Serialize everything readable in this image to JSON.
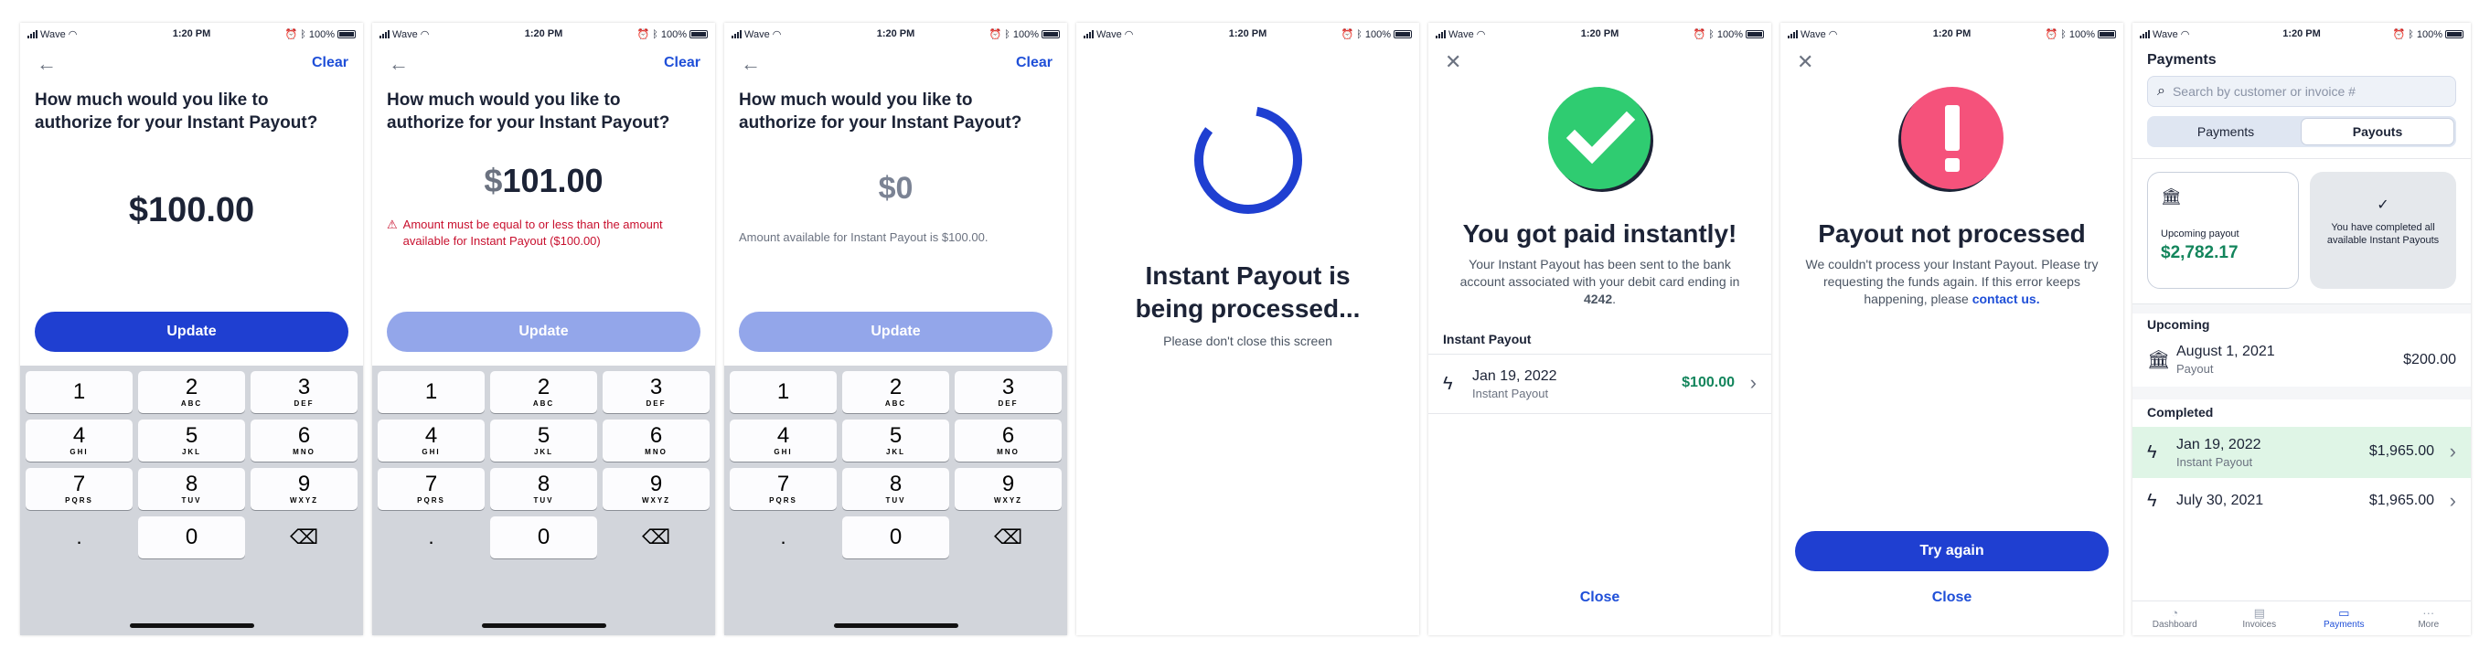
{
  "status": {
    "carrier": "Wave",
    "time": "1:20 PM",
    "battery": "100%"
  },
  "entry": {
    "question": "How much would you like to authorize for your Instant Payout?",
    "clear_label": "Clear",
    "update_label": "Update",
    "screens": [
      {
        "amount": "100.00",
        "message": ""
      },
      {
        "amount": "101.00",
        "message": "Amount must be equal to or less than the amount available for Instant Payout ($100.00)"
      },
      {
        "amount": "0",
        "message": "Amount available for Instant Payout is $100.00."
      }
    ]
  },
  "keypad": {
    "keys": [
      {
        "n": "1",
        "s": ""
      },
      {
        "n": "2",
        "s": "ABC"
      },
      {
        "n": "3",
        "s": "DEF"
      },
      {
        "n": "4",
        "s": "GHI"
      },
      {
        "n": "5",
        "s": "JKL"
      },
      {
        "n": "6",
        "s": "MNO"
      },
      {
        "n": "7",
        "s": "PQRS"
      },
      {
        "n": "8",
        "s": "TUV"
      },
      {
        "n": "9",
        "s": "WXYZ"
      }
    ],
    "dot": ".",
    "zero": "0",
    "delete_icon": "⌫"
  },
  "processing": {
    "title": "Instant Payout is being processed...",
    "subtitle": "Please don't close this screen",
    "spinner_color": "#1f3fd1"
  },
  "success": {
    "title": "You got paid instantly!",
    "body": "Your Instant Payout has been sent to the bank account associated with your debit card ending in",
    "card_last4": "4242",
    "section": "Instant Payout",
    "tx_date": "Jan 19, 2022",
    "tx_label": "Instant Payout",
    "tx_amount": "$100.00",
    "close_label": "Close",
    "icon_color": "#2fcc71"
  },
  "failure": {
    "title": "Payout not processed",
    "body": "We couldn't process your Instant Payout. Please try requesting the funds again. If this error keeps happening, please",
    "link": "contact us.",
    "try_again_label": "Try again",
    "close_label": "Close",
    "icon_color": "#f5527b"
  },
  "payments": {
    "title": "Payments",
    "search_placeholder": "Search by customer or invoice #",
    "tabs": [
      "Payments",
      "Payouts"
    ],
    "upcoming_card": {
      "label": "Upcoming payout",
      "amount": "$2,782.17"
    },
    "completed_card": {
      "text": "You have completed all available Instant Payouts"
    },
    "upcoming_header": "Upcoming",
    "upcoming": [
      {
        "date": "August 1, 2021",
        "label": "Payout",
        "amount": "$200.00"
      }
    ],
    "completed_header": "Completed",
    "completed": [
      {
        "date": "Jan 19, 2022",
        "label": "Instant Payout",
        "amount": "$1,965.00",
        "highlight": true
      },
      {
        "date": "July 30, 2021",
        "label": "",
        "amount": "$1,965.00",
        "highlight": false
      }
    ],
    "tabbar": [
      "Dashboard",
      "Invoices",
      "Payments",
      "More"
    ]
  },
  "colors": {
    "primary": "#1f3fd1",
    "primary_disabled": "#93a6ea",
    "link": "#1f4fd8",
    "error": "#c8102e",
    "positive": "#13855c",
    "highlight_row": "#dff5e6"
  }
}
